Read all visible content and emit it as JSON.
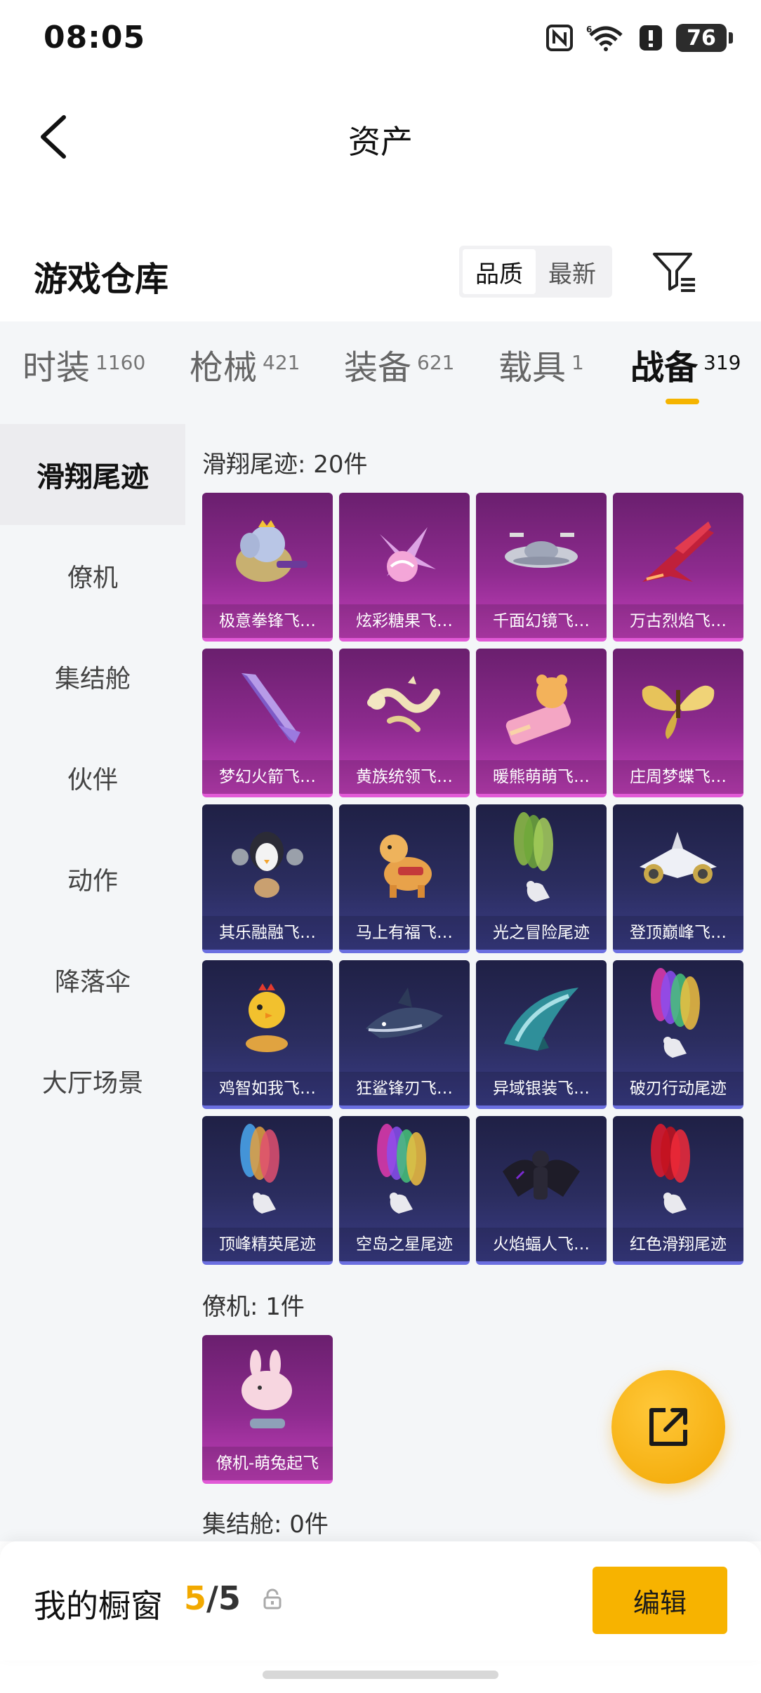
{
  "status_bar": {
    "time": "08:05",
    "battery": "76"
  },
  "header": {
    "title": "资产"
  },
  "warehouse": {
    "title": "游戏仓库",
    "sort_options": [
      "品质",
      "最新"
    ]
  },
  "tabs": [
    {
      "label": "时装",
      "count": "1160"
    },
    {
      "label": "枪械",
      "count": "421"
    },
    {
      "label": "装备",
      "count": "621"
    },
    {
      "label": "载具",
      "count": "1"
    },
    {
      "label": "战备",
      "count": "319"
    }
  ],
  "sidebar": {
    "items": [
      {
        "label": "滑翔尾迹"
      },
      {
        "label": "僚机"
      },
      {
        "label": "集结舱"
      },
      {
        "label": "伙伴"
      },
      {
        "label": "动作"
      },
      {
        "label": "降落伞"
      },
      {
        "label": "大厅场景"
      }
    ]
  },
  "sections": {
    "glide": {
      "heading": "滑翔尾迹: 20件"
    },
    "wingman": {
      "heading": "僚机: 1件"
    },
    "capsule": {
      "heading": "集结舱: 0件"
    }
  },
  "items": [
    {
      "label": "极意拳锋飞…",
      "rarity": "purple",
      "icon": "elephant-glider-icon"
    },
    {
      "label": "炫彩糖果飞…",
      "rarity": "purple",
      "icon": "candy-glider-icon"
    },
    {
      "label": "千面幻镜飞…",
      "rarity": "purple",
      "icon": "ufo-glider-icon"
    },
    {
      "label": "万古烈焰飞…",
      "rarity": "purple",
      "icon": "flame-jet-icon"
    },
    {
      "label": "梦幻火箭飞…",
      "rarity": "purple",
      "icon": "rocket-wing-icon"
    },
    {
      "label": "黄族统领飞…",
      "rarity": "purple",
      "icon": "dragon-glider-icon"
    },
    {
      "label": "暖熊萌萌飞…",
      "rarity": "purple",
      "icon": "bear-bed-glider-icon"
    },
    {
      "label": "庄周梦蝶飞…",
      "rarity": "purple",
      "icon": "butterfly-glider-icon"
    },
    {
      "label": "其乐融融飞…",
      "rarity": "blue",
      "icon": "penguin-glider-icon"
    },
    {
      "label": "马上有福飞…",
      "rarity": "blue",
      "icon": "horse-glider-icon"
    },
    {
      "label": "光之冒险尾迹",
      "rarity": "blue",
      "icon": "green-smoke-trail-icon"
    },
    {
      "label": "登顶巅峰飞…",
      "rarity": "blue",
      "icon": "jet-glider-icon"
    },
    {
      "label": "鸡智如我飞…",
      "rarity": "blue",
      "icon": "chicken-glider-icon"
    },
    {
      "label": "狂鲨锋刃飞…",
      "rarity": "blue",
      "icon": "shark-glider-icon"
    },
    {
      "label": "异域银装飞…",
      "rarity": "blue",
      "icon": "teal-wing-glider-icon"
    },
    {
      "label": "破刃行动尾迹",
      "rarity": "blue",
      "icon": "rainbow-smoke-trail-icon"
    },
    {
      "label": "顶峰精英尾迹",
      "rarity": "blue",
      "icon": "colorful-smoke-trail-icon"
    },
    {
      "label": "空岛之星尾迹",
      "rarity": "blue",
      "icon": "rainbow-smoke-trail-icon"
    },
    {
      "label": "火焰蝠人飞…",
      "rarity": "blue",
      "icon": "bat-suit-glider-icon"
    },
    {
      "label": "红色滑翔尾迹",
      "rarity": "blue",
      "icon": "red-smoke-trail-icon"
    }
  ],
  "wingman_items": [
    {
      "label": "僚机-萌兔起飞",
      "rarity": "purple",
      "icon": "bunny-wingman-icon"
    }
  ],
  "bottom_bar": {
    "label": "我的橱窗",
    "current": "5",
    "separator": "/",
    "max": "5",
    "edit_label": "编辑"
  },
  "colors": {
    "accent": "#f7b300",
    "purple_card": "#8e2b8f",
    "blue_card": "#2b2d5f",
    "background": "#f4f6f8"
  }
}
